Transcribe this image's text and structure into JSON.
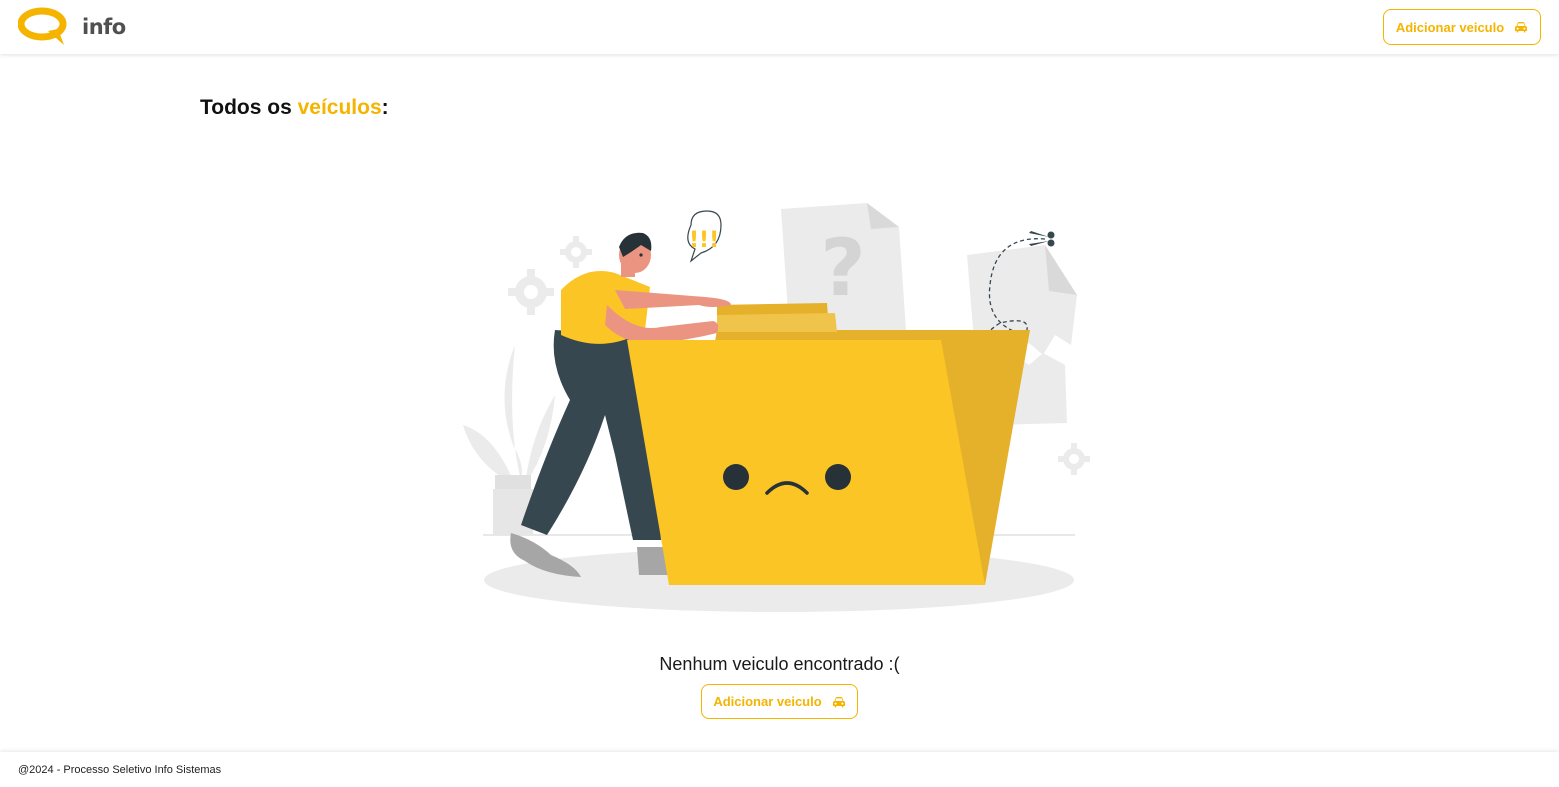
{
  "header": {
    "logo_text": "info",
    "add_button_label": "Adicionar veiculo",
    "add_button_icon": "car-icon"
  },
  "main": {
    "title_prefix": "Todos os ",
    "title_accent": "veículos",
    "title_suffix": ":",
    "empty_message": "Nenhum veiculo encontrado :(",
    "empty_button_label": "Adicionar veiculo",
    "illustration_exclamation": "!!!",
    "illustration_question": "?"
  },
  "footer": {
    "copyright": "@2024 - Processo Seletivo Info Sistemas"
  },
  "colors": {
    "accent": "#f5b400",
    "folder": "#fcc526",
    "folder_dark": "#e5b12a",
    "pants": "#37474f",
    "skin": "#eb9481",
    "gray_light": "#ebebeb"
  }
}
